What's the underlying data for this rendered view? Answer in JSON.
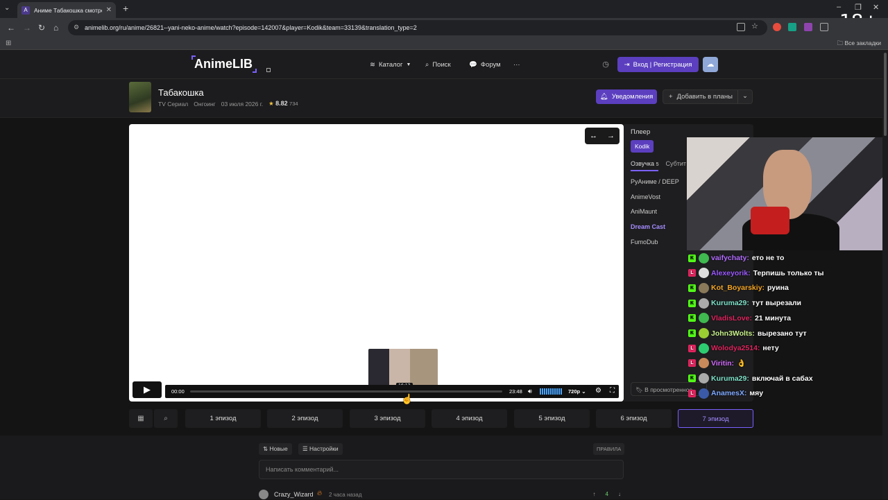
{
  "browser": {
    "tab_title": "Аниме Табакошка смотреть о",
    "tab_favicon": "A",
    "url": "animelib.org/ru/anime/26821--yani-neko-anime/watch?episode=142007&player=Kodik&team=33139&translation_type=2",
    "bookmarks_label": "Все закладки",
    "overlay_badge": "18+"
  },
  "header": {
    "logo": "AnimeLIB",
    "nav": [
      {
        "label": "Каталог",
        "icon": "layers-icon"
      },
      {
        "label": "Поиск",
        "icon": "search-icon"
      },
      {
        "label": "Форум",
        "icon": "chat-icon"
      }
    ],
    "more": "···",
    "login_label": "Вход | Регистрация"
  },
  "anime": {
    "title": "Табакошка",
    "type": "TV Сериал",
    "status": "Онгоинг",
    "date": "03 июля 2026 г.",
    "score": "8.82",
    "votes": "734",
    "notify_label": "Уведомления",
    "plans_label": "Добавить в планы"
  },
  "player": {
    "current_time": "00:00",
    "duration": "23:48",
    "quality": "720p",
    "preview_time": "16:13",
    "progress": 0
  },
  "side_panel": {
    "title": "Плеер",
    "player_name": "Kodik",
    "tab_voice": "Озвучка",
    "tab_voice_count": "5",
    "tab_subs": "Субтит",
    "teams": [
      "РуАниме / DEEP",
      "AnimeVost",
      "AniMaunt",
      "Dream Cast",
      "FumoDub"
    ],
    "selected_team": "Dream Cast",
    "watched_label": "В просмотренное"
  },
  "chat": [
    {
      "platform": "kick",
      "nick": "vaifychaty:",
      "color": "#b36cff",
      "text": "ето не то"
    },
    {
      "platform": "live",
      "nick": "Alexeyorik:",
      "color": "#9b59ff",
      "text": "Терпишь только ты"
    },
    {
      "platform": "kick",
      "nick": "Kot_Boyarskiy:",
      "color": "#f5a623",
      "text": "руина"
    },
    {
      "platform": "kick",
      "nick": "Kuruma29:",
      "color": "#7ee0c8",
      "text": "тут вырезали"
    },
    {
      "platform": "kick",
      "nick": "VladisLove:",
      "color": "#e0245e",
      "text": "21 минута"
    },
    {
      "platform": "kick",
      "nick": "John3Wolts:",
      "color": "#c8f28a",
      "text": "вырезано тут"
    },
    {
      "platform": "live",
      "nick": "Wolodya2514:",
      "color": "#e0245e",
      "text": "нету"
    },
    {
      "platform": "live",
      "nick": "Viritin:",
      "color": "#d26bff",
      "text": "👌"
    },
    {
      "platform": "kick",
      "nick": "Kuruma29:",
      "color": "#7ee0c8",
      "text": "включай в сабах"
    },
    {
      "platform": "live",
      "nick": "AnamesX:",
      "color": "#7ea8ff",
      "text": "мяу"
    }
  ],
  "episodes": [
    "1 эпизод",
    "2 эпизод",
    "3 эпизод",
    "4 эпизод",
    "5 эпизод",
    "6 эпизод",
    "7 эпизод"
  ],
  "current_episode": "7 эпизод",
  "comments": {
    "sort_label": "Новые",
    "settings_label": "Настройки",
    "rules_label": "ПРАВИЛА",
    "input_placeholder": "Написать комментарий...",
    "first": {
      "author": "Crazy_Wizard",
      "time": "2 часа назад",
      "votes": "4"
    }
  },
  "colors": {
    "accent": "#5b3fbf",
    "accent_light": "#a58cff",
    "kick": "#53fc18",
    "live": "#e0245e"
  }
}
